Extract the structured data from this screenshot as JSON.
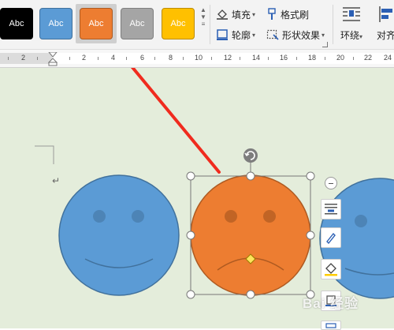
{
  "ribbon": {
    "style_swatches": [
      {
        "label": "Abc",
        "fill": "#000000",
        "border": "#000000"
      },
      {
        "label": "Abc",
        "fill": "#5b9bd5",
        "border": "#41719c"
      },
      {
        "label": "Abc",
        "fill": "#ed7d31",
        "border": "#ae5a21",
        "selected": true
      },
      {
        "label": "Abc",
        "fill": "#a5a5a5",
        "border": "#7f7f7f"
      },
      {
        "label": "Abc",
        "fill": "#ffc000",
        "border": "#bc8c00"
      }
    ],
    "fill_label": "填充",
    "outline_label": "轮廓",
    "format_painter_label": "格式刷",
    "shape_effects_label": "形状效果",
    "wrap_label": "环绕",
    "align_label": "对齐"
  },
  "ruler": {
    "numbers": [
      "2",
      "2",
      "4",
      "6",
      "8",
      "10",
      "12",
      "14",
      "16",
      "18",
      "20",
      "22",
      "24"
    ]
  },
  "document": {
    "paragraph_mark": "↵",
    "shapes": [
      {
        "name": "smiley-face",
        "fill": "#5b9bd5",
        "stroke": "#41719c"
      },
      {
        "name": "frowning-face",
        "fill": "#ed7d31",
        "stroke": "#ae5a21",
        "selected": true
      },
      {
        "name": "partial-face",
        "fill": "#5b9bd5",
        "stroke": "#41719c"
      }
    ]
  },
  "annotation": {
    "arrow_color": "#f02b1e"
  },
  "watermark": {
    "text": "Bai 经验"
  }
}
